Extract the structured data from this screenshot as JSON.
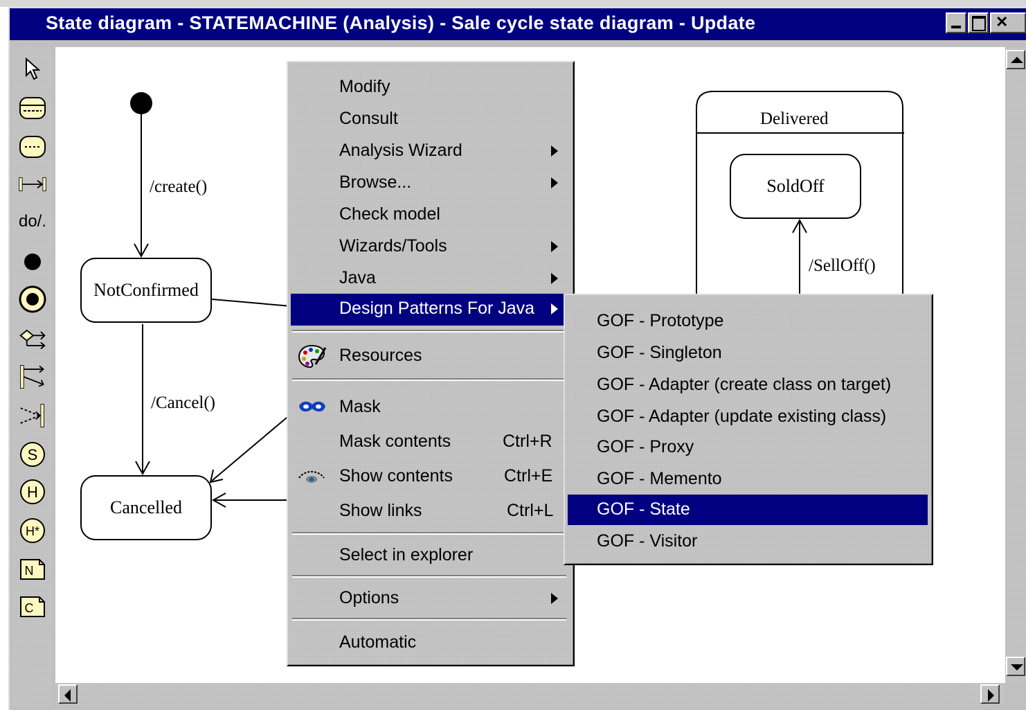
{
  "window": {
    "title": "State diagram - STATEMACHINE  (Analysis) - Sale cycle state diagram - Update",
    "buttons": [
      "minimize-icon",
      "maximize-icon",
      "close-icon"
    ]
  },
  "toolbar": {
    "tools": [
      "pointer-icon",
      "state-icon",
      "substate-icon",
      "transition-icon",
      "do-action-icon",
      "initial-state-icon",
      "final-state-icon",
      "condition-icon",
      "fork-icon",
      "join-icon",
      "shallow-history-s-icon",
      "history-h-icon",
      "deep-history-h-star-icon",
      "note-icon",
      "constraint-icon"
    ],
    "do_label": "do/.",
    "s_label": "S",
    "h_label": "H",
    "hstar_label": "H*",
    "note_label": "N",
    "constraint_label": "C"
  },
  "diagram": {
    "states": {
      "not_confirmed": "NotConfirmed",
      "cancelled": "Cancelled",
      "delivered": "Delivered",
      "sold_off": "SoldOff"
    },
    "transitions": {
      "create": "/create()",
      "cancel": "/Cancel()",
      "sell_off": "/SellOff()"
    }
  },
  "context_menu": {
    "items": [
      {
        "label": "Modify",
        "submenu": false
      },
      {
        "label": "Consult",
        "submenu": false
      },
      {
        "label": "Analysis Wizard",
        "submenu": true
      },
      {
        "label": "Browse...",
        "submenu": true
      },
      {
        "label": "Check model",
        "submenu": false
      },
      {
        "label": "Wizards/Tools",
        "submenu": true
      },
      {
        "label": "Java",
        "submenu": true
      },
      {
        "label": "Design Patterns For Java",
        "submenu": true,
        "highlighted": true
      },
      {
        "label": "Resources",
        "icon": "palette-icon"
      },
      {
        "label": "Mask",
        "icon": "mask-icon"
      },
      {
        "label": "Mask contents",
        "shortcut": "Ctrl+R"
      },
      {
        "label": "Show contents",
        "shortcut": "Ctrl+E",
        "icon": "show-eye-icon"
      },
      {
        "label": "Show links",
        "shortcut": "Ctrl+L"
      },
      {
        "label": "Select in explorer"
      },
      {
        "label": "Options",
        "submenu": true
      },
      {
        "label": "Automatic"
      }
    ]
  },
  "submenu": {
    "items": [
      "GOF - Prototype",
      "GOF - Singleton",
      "GOF - Adapter (create class on target)",
      "GOF - Adapter (update existing class)",
      "GOF - Proxy",
      "GOF - Memento",
      "GOF - State",
      "GOF - Visitor"
    ],
    "selected": "GOF - State"
  },
  "colors": {
    "titlebar": "#000080",
    "highlight": "#000080",
    "face": "#c0c0c0",
    "tool_fill": "#fff7c0"
  }
}
